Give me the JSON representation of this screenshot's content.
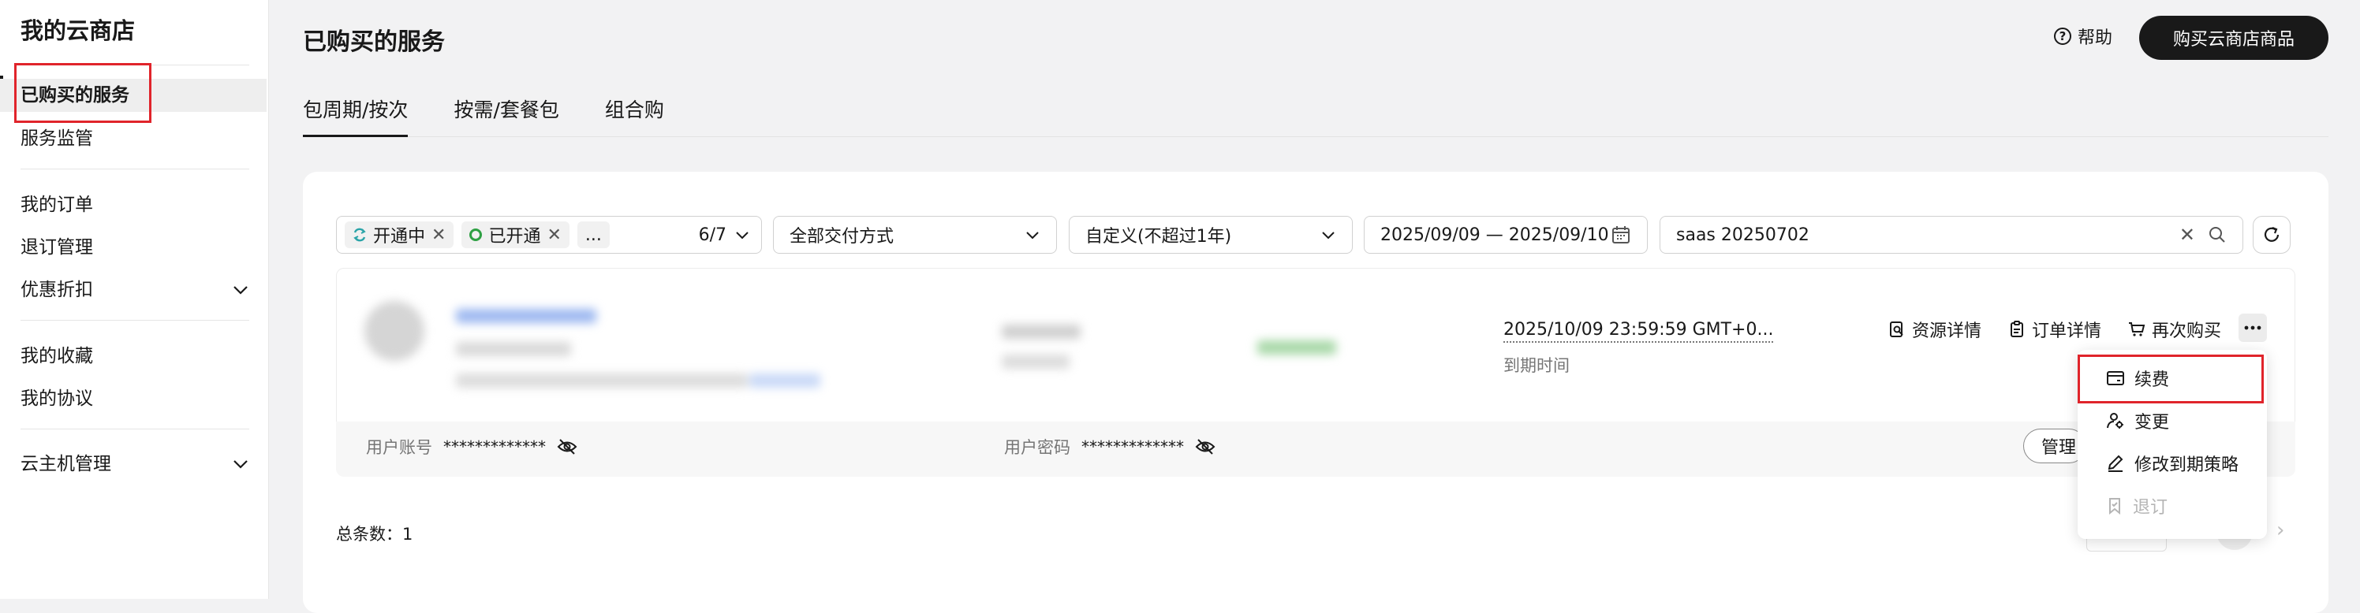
{
  "sidebar": {
    "brand": "我的云商店",
    "items": [
      {
        "label": "已购买的服务"
      },
      {
        "label": "服务监管"
      },
      {
        "label": "我的订单"
      },
      {
        "label": "退订管理"
      },
      {
        "label": "优惠折扣"
      },
      {
        "label": "我的收藏"
      },
      {
        "label": "我的协议"
      },
      {
        "label": "云主机管理"
      }
    ]
  },
  "header": {
    "title": "已购买的服务",
    "help": "帮助",
    "buy_button": "购买云商店商品"
  },
  "tabs": [
    {
      "label": "包周期/按次",
      "active": true
    },
    {
      "label": "按需/套餐包",
      "active": false
    },
    {
      "label": "组合购",
      "active": false
    }
  ],
  "filters": {
    "status_chips": [
      "开通中",
      "已开通",
      "..."
    ],
    "status_count": "6/7",
    "delivery": "全部交付方式",
    "custom_range": "自定义(不超过1年)",
    "date_range": "2025/09/09 — 2025/09/10",
    "search_value": "saas 20250702"
  },
  "row": {
    "expire_time": "2025/10/09 23:59:59 GMT+0...",
    "expire_label": "到期时间",
    "actions": [
      "资源详情",
      "订单详情",
      "再次购买"
    ],
    "user_account_label": "用户账号",
    "user_account_mask": "*************",
    "user_password_label": "用户密码",
    "user_password_mask": "*************",
    "manage_button": "管理"
  },
  "more_menu": {
    "items": [
      {
        "label": "续费",
        "icon": "card-icon",
        "disabled": false
      },
      {
        "label": "变更",
        "icon": "user-gear-icon",
        "disabled": false
      },
      {
        "label": "修改到期策略",
        "icon": "pencil-icon",
        "disabled": false
      },
      {
        "label": "退订",
        "icon": "bookmark-icon",
        "disabled": true
      }
    ]
  },
  "footer": {
    "total": "总条数：1"
  },
  "colors": {
    "accent_dark": "#191919",
    "highlight_red": "#e0242b",
    "status_sync": "#2ba4a8",
    "status_ok": "#2ea043"
  }
}
